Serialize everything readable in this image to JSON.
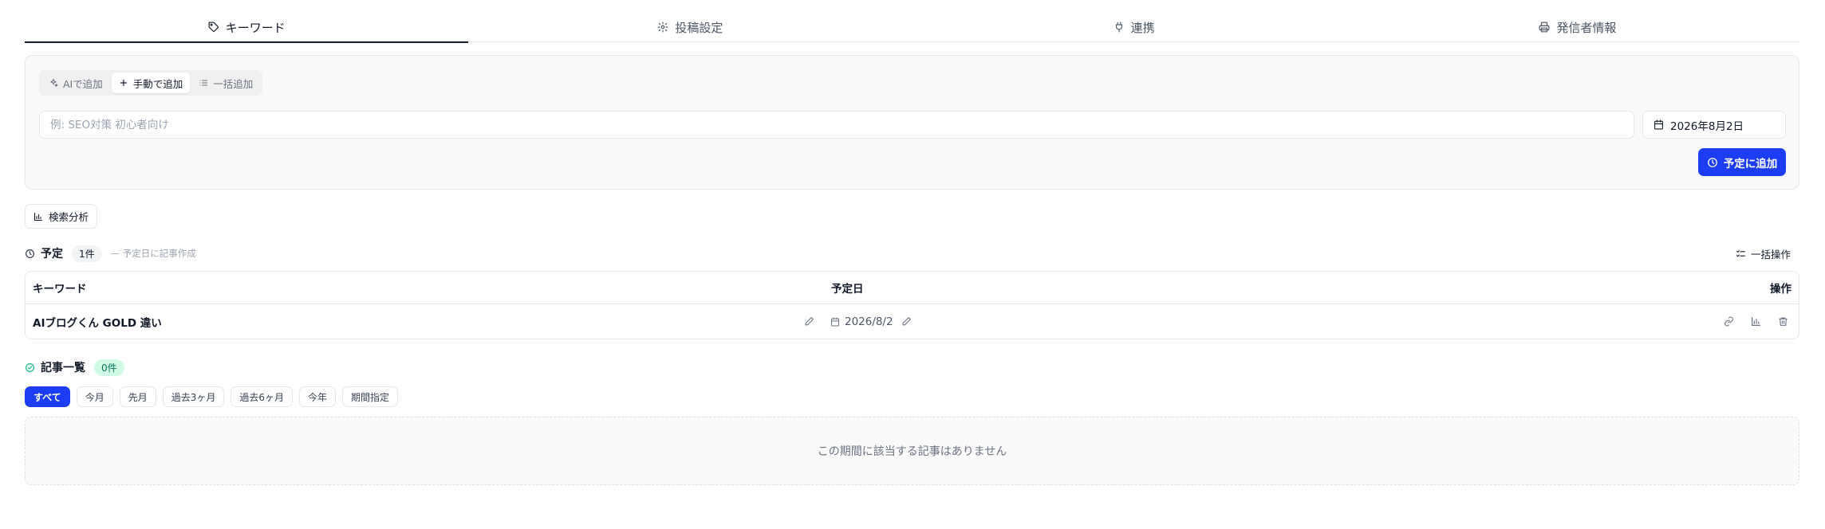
{
  "tabs": [
    {
      "label": "キーワード",
      "icon": "tag-icon",
      "active": true
    },
    {
      "label": "投稿設定",
      "icon": "gear-icon",
      "active": false
    },
    {
      "label": "連携",
      "icon": "plug-icon",
      "active": false
    },
    {
      "label": "発信者情報",
      "icon": "printer-icon",
      "active": false
    }
  ],
  "add_panel": {
    "modes": [
      {
        "label": "AIで追加",
        "icon": "sparkles-icon",
        "active": false
      },
      {
        "label": "手動で追加",
        "icon": "plus-icon",
        "active": true
      },
      {
        "label": "一括追加",
        "icon": "list-icon",
        "active": false
      }
    ],
    "keyword_input": {
      "placeholder": "例: SEO対策 初心者向け",
      "value": ""
    },
    "date_value": "2026年8月2日",
    "schedule_button": "予定に追加"
  },
  "search_analysis_button": "検索分析",
  "scheduled": {
    "title": "予定",
    "count": "1件",
    "note": "— 予定日に記事作成",
    "bulk_action": "一括操作",
    "columns": {
      "keyword": "キーワード",
      "date": "予定日",
      "actions": "操作"
    },
    "rows": [
      {
        "keyword": "AIブログくん GOLD 違い",
        "date": "2026/8/2"
      }
    ]
  },
  "articles": {
    "title": "記事一覧",
    "count": "0件",
    "filters": [
      "すべて",
      "今月",
      "先月",
      "過去3ヶ月",
      "過去6ヶ月",
      "今年",
      "期間指定"
    ],
    "active_filter": "すべて",
    "empty_message": "この期間に該当する記事はありません"
  },
  "colors": {
    "primary": "#1d3df5",
    "border": "#e5e7eb",
    "success": "#10b981",
    "success_bg": "#d1fae5"
  }
}
